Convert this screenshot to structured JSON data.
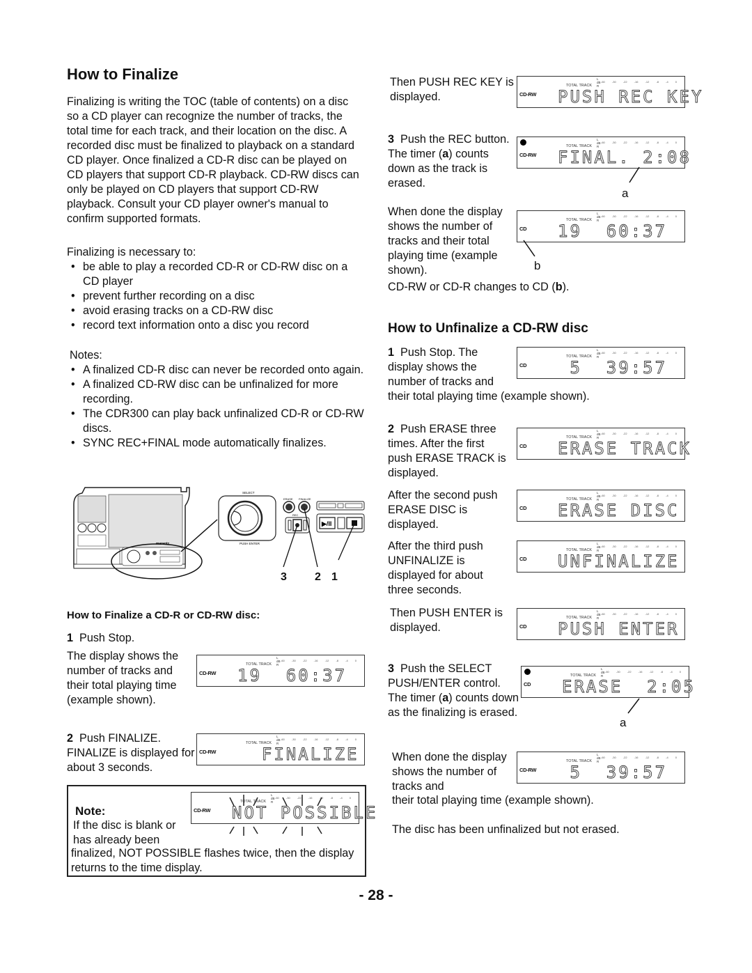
{
  "page_number": "- 28 -",
  "left": {
    "title": "How to Finalize",
    "intro": "Finalizing is writing the TOC (table of contents) on a disc so a CD player can recognize the number of tracks, the total time for each track, and their location on the disc.  A recorded disc must be finalized to playback on a standard CD player.  Once finalized a CD-R disc can be played on CD players that support CD-R playback.  CD-RW discs can only be played on CD players that support CD-RW playback.  Consult your CD player owner's manual to confirm supported formats.",
    "necessary_heading": "Finalizing is necessary to:",
    "necessary_items": [
      "be able to play a recorded CD-R or CD-RW disc on a CD player",
      "prevent further recording on a disc",
      "avoid erasing tracks on a CD-RW disc",
      "record text information onto a disc you record"
    ],
    "notes_heading": "Notes:",
    "notes_items": [
      "A finalized CD-R disc can never be recorded onto again.",
      "A finalized CD-RW disc can be unfinalized for more recording.",
      "The CDR300 can play back unfinalized CD-R or CD-RW discs.",
      "SYNC REC+FINAL mode automatically finalizes."
    ],
    "illustration": {
      "labels": {
        "select": "SELECT",
        "push_enter": "PUSH ENTER",
        "erase": "ERASE",
        "finalize": "FINALIZE",
        "rec": "REC",
        "brand": "marantz"
      },
      "callouts": [
        "3",
        "2",
        "1"
      ]
    },
    "subheading": "How to Finalize a CD-R or CD-RW disc:",
    "step1_num": "1",
    "step1_title": "Push Stop.",
    "step1_desc": "The display shows the number of tracks and their total playing time (example shown).",
    "step2_num": "2",
    "step2_title": "Push FINALIZE.",
    "step2_desc": "FINALIZE is displayed for about 3 seconds.",
    "note_title": "Note:",
    "note_text_a": "If the disc is blank or has already been",
    "note_text_b": "finalized, NOT POSSIBLE flashes twice, then the display returns to the time display."
  },
  "right": {
    "push_rec_key_text": "Then PUSH REC KEY is displayed.",
    "step3_num": "3",
    "step3_text": "Push the REC button. The timer (",
    "step3_bold": "a",
    "step3_tail": ") counts down as the track is erased.",
    "done_text": "When done the display shows the number of tracks and their total playing time (example shown).",
    "changes_a": "CD-RW or CD-R changes to CD (",
    "changes_bold": "b",
    "changes_b": ").",
    "unfinalize_title": "How to Unfinalize a CD-RW disc",
    "u_step1_num": "1",
    "u_step1_text": "Push Stop.  The display shows the number of tracks and",
    "u_step1_cont": "their total playing time (example shown).",
    "u_step2_num": "2",
    "u_step2_text": "Push ERASE three times. After the first push ERASE TRACK is displayed.",
    "second_push": "After the second push ERASE DISC is displayed.",
    "third_push": "After the third push UNFINALIZE is displayed for about three seconds.",
    "push_enter_text": "Then PUSH ENTER is displayed.",
    "u_step3_num": "3",
    "u_step3_text": "Push the SELECT PUSH/ENTER control. The timer (",
    "u_step3_bold": "a",
    "u_step3_tail": ") counts down as the finalizing is erased.",
    "u_done_text": "When done the display shows the number of tracks and",
    "u_done_cont": "their total playing time (example shown).",
    "final_note": "The disc has been unfinalized but not erased.",
    "callout_a": "a",
    "callout_b": "b"
  },
  "lcd_common": {
    "total_track": "TOTAL TRACK",
    "lr": "L\ndB\nR",
    "meter": "-60 -30 -22 -16 -12 -8 -4 0"
  },
  "displays": {
    "push_rec_key": {
      "disc": "CD-RW",
      "text": "PUSH REC KEY",
      "rec_dot": false
    },
    "final_timer": {
      "disc": "CD-RW",
      "text": "FINAL. 2:08",
      "rec_dot": true
    },
    "done_cd": {
      "disc": "CD",
      "text": "19  60:37",
      "rec_dot": false
    },
    "u_stop": {
      "disc": "CD",
      "text": " 5  39:57",
      "rec_dot": false
    },
    "erase_track": {
      "disc": "CD",
      "text": "ERASE TRACK",
      "rec_dot": false
    },
    "erase_disc": {
      "disc": "CD",
      "text": "ERASE DISC",
      "rec_dot": false
    },
    "unfinalize": {
      "disc": "CD",
      "text": "UNFINALIZE",
      "rec_dot": false
    },
    "push_enter": {
      "disc": "CD",
      "text": "PUSH ENTER",
      "rec_dot": false
    },
    "erase_timer": {
      "disc": "CD",
      "text": "ERASE  2:05",
      "rec_dot": true
    },
    "u_done": {
      "disc": "CD-RW",
      "text": " 5  39:57",
      "rec_dot": false
    },
    "l_stop": {
      "disc": "CD-RW",
      "text": "19  60:37",
      "rec_dot": false
    },
    "l_finalize": {
      "disc": "CD-RW",
      "text": "  FINALIZE",
      "rec_dot": false
    },
    "not_possible": {
      "disc": "CD-RW",
      "text": "NOT POSSIBLE",
      "rec_dot": false
    }
  }
}
